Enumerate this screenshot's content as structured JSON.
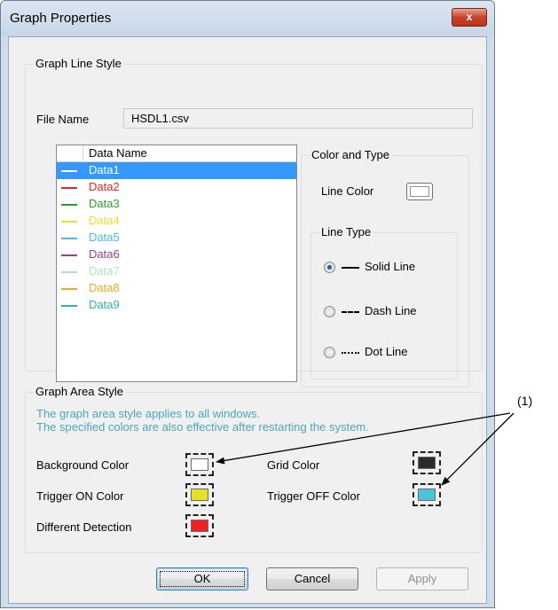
{
  "window": {
    "title": "Graph Properties",
    "close_label": "x"
  },
  "line_style": {
    "group_title": "Graph Line Style",
    "file_name_label": "File Name",
    "file_name_value": "HSDL1.csv",
    "column_header": "Data Name",
    "items": [
      {
        "name": "Data1",
        "color": "#ffffff",
        "selected": true
      },
      {
        "name": "Data2",
        "color": "#ee2222"
      },
      {
        "name": "Data3",
        "color": "#2aa02a"
      },
      {
        "name": "Data4",
        "color": "#e8e22a"
      },
      {
        "name": "Data5",
        "color": "#45c0d8"
      },
      {
        "name": "Data6",
        "color": "#9b3b9b"
      },
      {
        "name": "Data7",
        "color": "#b9dcc4"
      },
      {
        "name": "Data8",
        "color": "#f2a81e"
      },
      {
        "name": "Data9",
        "color": "#2ab5a9"
      }
    ],
    "color_type_title": "Color and Type",
    "line_color_label": "Line Color",
    "line_color": "#ffffff",
    "line_type_title": "Line Type",
    "line_types": [
      {
        "label": "Solid Line",
        "checked": true
      },
      {
        "label": "Dash Line",
        "checked": false
      },
      {
        "label": "Dot Line",
        "checked": false
      }
    ]
  },
  "area_style": {
    "group_title": "Graph Area Style",
    "info_line1": "The graph area style applies to all windows.",
    "info_line2": "The specified colors are also effective after restarting the system.",
    "background_color_label": "Background Color",
    "background_color": "#ffffff",
    "grid_color_label": "Grid Color",
    "grid_color": "#2b2b2b",
    "trigger_on_label": "Trigger ON Color",
    "trigger_on_color": "#e6e02a",
    "trigger_off_label": "Trigger OFF Color",
    "trigger_off_color": "#4ac4d6",
    "diff_detection_label": "Different Detection",
    "diff_detection_color": "#ee2222"
  },
  "buttons": {
    "ok": "OK",
    "cancel": "Cancel",
    "apply": "Apply"
  },
  "callout": {
    "label": "(1)"
  }
}
